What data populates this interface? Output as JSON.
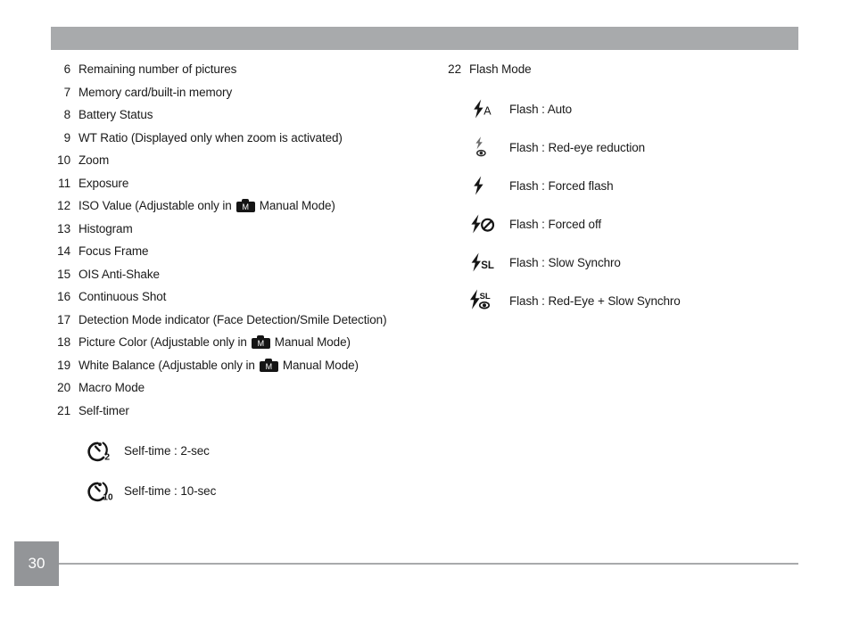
{
  "page": {
    "number": "30"
  },
  "left_column": {
    "items": [
      {
        "num": "6",
        "text": "Remaining number of pictures"
      },
      {
        "num": "7",
        "text": "Memory card/built-in memory"
      },
      {
        "num": "8",
        "text": "Battery Status"
      },
      {
        "num": "9",
        "text": "WT Ratio (Displayed only when zoom is activated)"
      },
      {
        "num": "10",
        "text": "Zoom"
      },
      {
        "num": "11",
        "text": "Exposure"
      },
      {
        "num": "12",
        "text_before": "ISO Value (Adjustable only in",
        "icon": "camera-manual-mode-icon",
        "icon_label": "M",
        "text_after": "Manual Mode)"
      },
      {
        "num": "13",
        "text": "Histogram"
      },
      {
        "num": "14",
        "text": "Focus Frame"
      },
      {
        "num": "15",
        "text": "OIS Anti-Shake"
      },
      {
        "num": "16",
        "text": "Continuous Shot"
      },
      {
        "num": "17",
        "text": "Detection Mode indicator (Face Detection/Smile Detection)"
      },
      {
        "num": "18",
        "text_before": "Picture Color (Adjustable only in",
        "icon": "camera-manual-mode-icon",
        "icon_label": "M",
        "text_after": "Manual Mode)"
      },
      {
        "num": "19",
        "text_before": "White Balance (Adjustable only in",
        "icon": "camera-manual-mode-icon",
        "icon_label": "M",
        "text_after": "Manual Mode)"
      },
      {
        "num": "20",
        "text": "Macro Mode"
      },
      {
        "num": "21",
        "text": "Self-timer"
      }
    ],
    "self_timer_modes": [
      {
        "icon": "stopwatch-2sec-icon",
        "icon_digits": "2",
        "label": "Self-time : 2-sec"
      },
      {
        "icon": "stopwatch-10sec-icon",
        "icon_digits": "10",
        "label": "Self-time : 10-sec"
      }
    ]
  },
  "right_column": {
    "heading": {
      "num": "22",
      "text": "Flash Mode"
    },
    "flash_modes": [
      {
        "icon": "flash-auto-icon",
        "icon_text": "A",
        "label": "Flash : Auto"
      },
      {
        "icon": "flash-red-eye-reduction-icon",
        "icon_text": "",
        "label": "Flash : Red-eye reduction"
      },
      {
        "icon": "flash-forced-flash-icon",
        "icon_text": "",
        "label": "Flash : Forced flash"
      },
      {
        "icon": "flash-forced-off-icon",
        "icon_text": "",
        "label": "Flash : Forced off"
      },
      {
        "icon": "flash-slow-synchro-icon",
        "icon_text": "SL",
        "label": "Flash : Slow Synchro"
      },
      {
        "icon": "flash-red-eye-slow-synchro-icon",
        "icon_text": "SL",
        "label": "Flash : Red-Eye + Slow Synchro"
      }
    ]
  },
  "colors": {
    "header_band": "#a8aaac",
    "footer_box": "#939598",
    "footer_rule": "#a8aaac",
    "text": "#1a1a1a"
  }
}
